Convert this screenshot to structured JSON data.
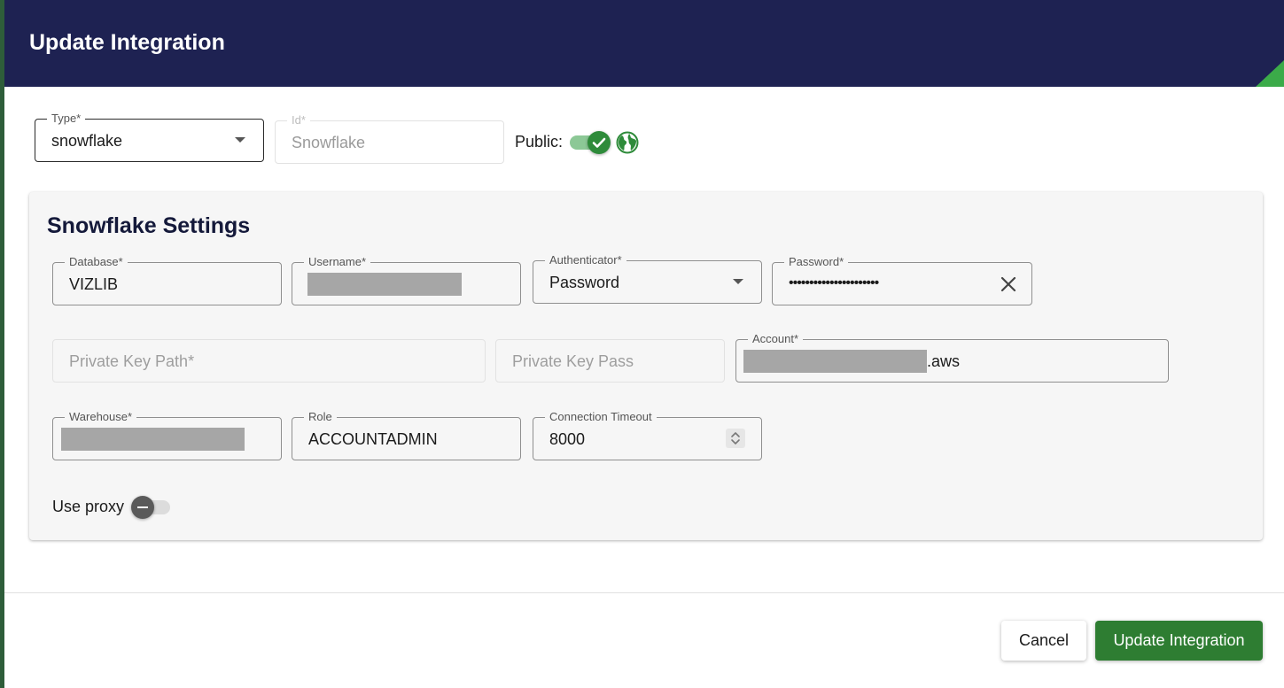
{
  "dialog": {
    "title": "Update Integration"
  },
  "top": {
    "type": {
      "label": "Type*",
      "value": "snowflake"
    },
    "id": {
      "label": "Id*",
      "value": "Snowflake"
    },
    "public_label": "Public:",
    "public_enabled": true
  },
  "settings": {
    "title": "Snowflake Settings",
    "database": {
      "label": "Database*",
      "value": "VIZLIB"
    },
    "username": {
      "label": "Username*",
      "value": ""
    },
    "authenticator": {
      "label": "Authenticator*",
      "value": "Password"
    },
    "password": {
      "label": "Password*",
      "value": "••••••••••••••••••••••"
    },
    "private_key_path": {
      "placeholder": "Private Key Path*"
    },
    "private_key_pass": {
      "placeholder": "Private Key Pass"
    },
    "account": {
      "label": "Account*",
      "value_suffix": ".aws"
    },
    "warehouse": {
      "label": "Warehouse*",
      "value": ""
    },
    "role": {
      "label": "Role",
      "value": "ACCOUNTADMIN"
    },
    "connection_timeout": {
      "label": "Connection Timeout",
      "value": "8000"
    },
    "use_proxy": {
      "label": "Use proxy",
      "enabled": false
    }
  },
  "footer": {
    "cancel_label": "Cancel",
    "update_label": "Update Integration"
  },
  "colors": {
    "header": "#1e2252",
    "accent": "#2e7d32",
    "panel": "#f6f6f6"
  }
}
